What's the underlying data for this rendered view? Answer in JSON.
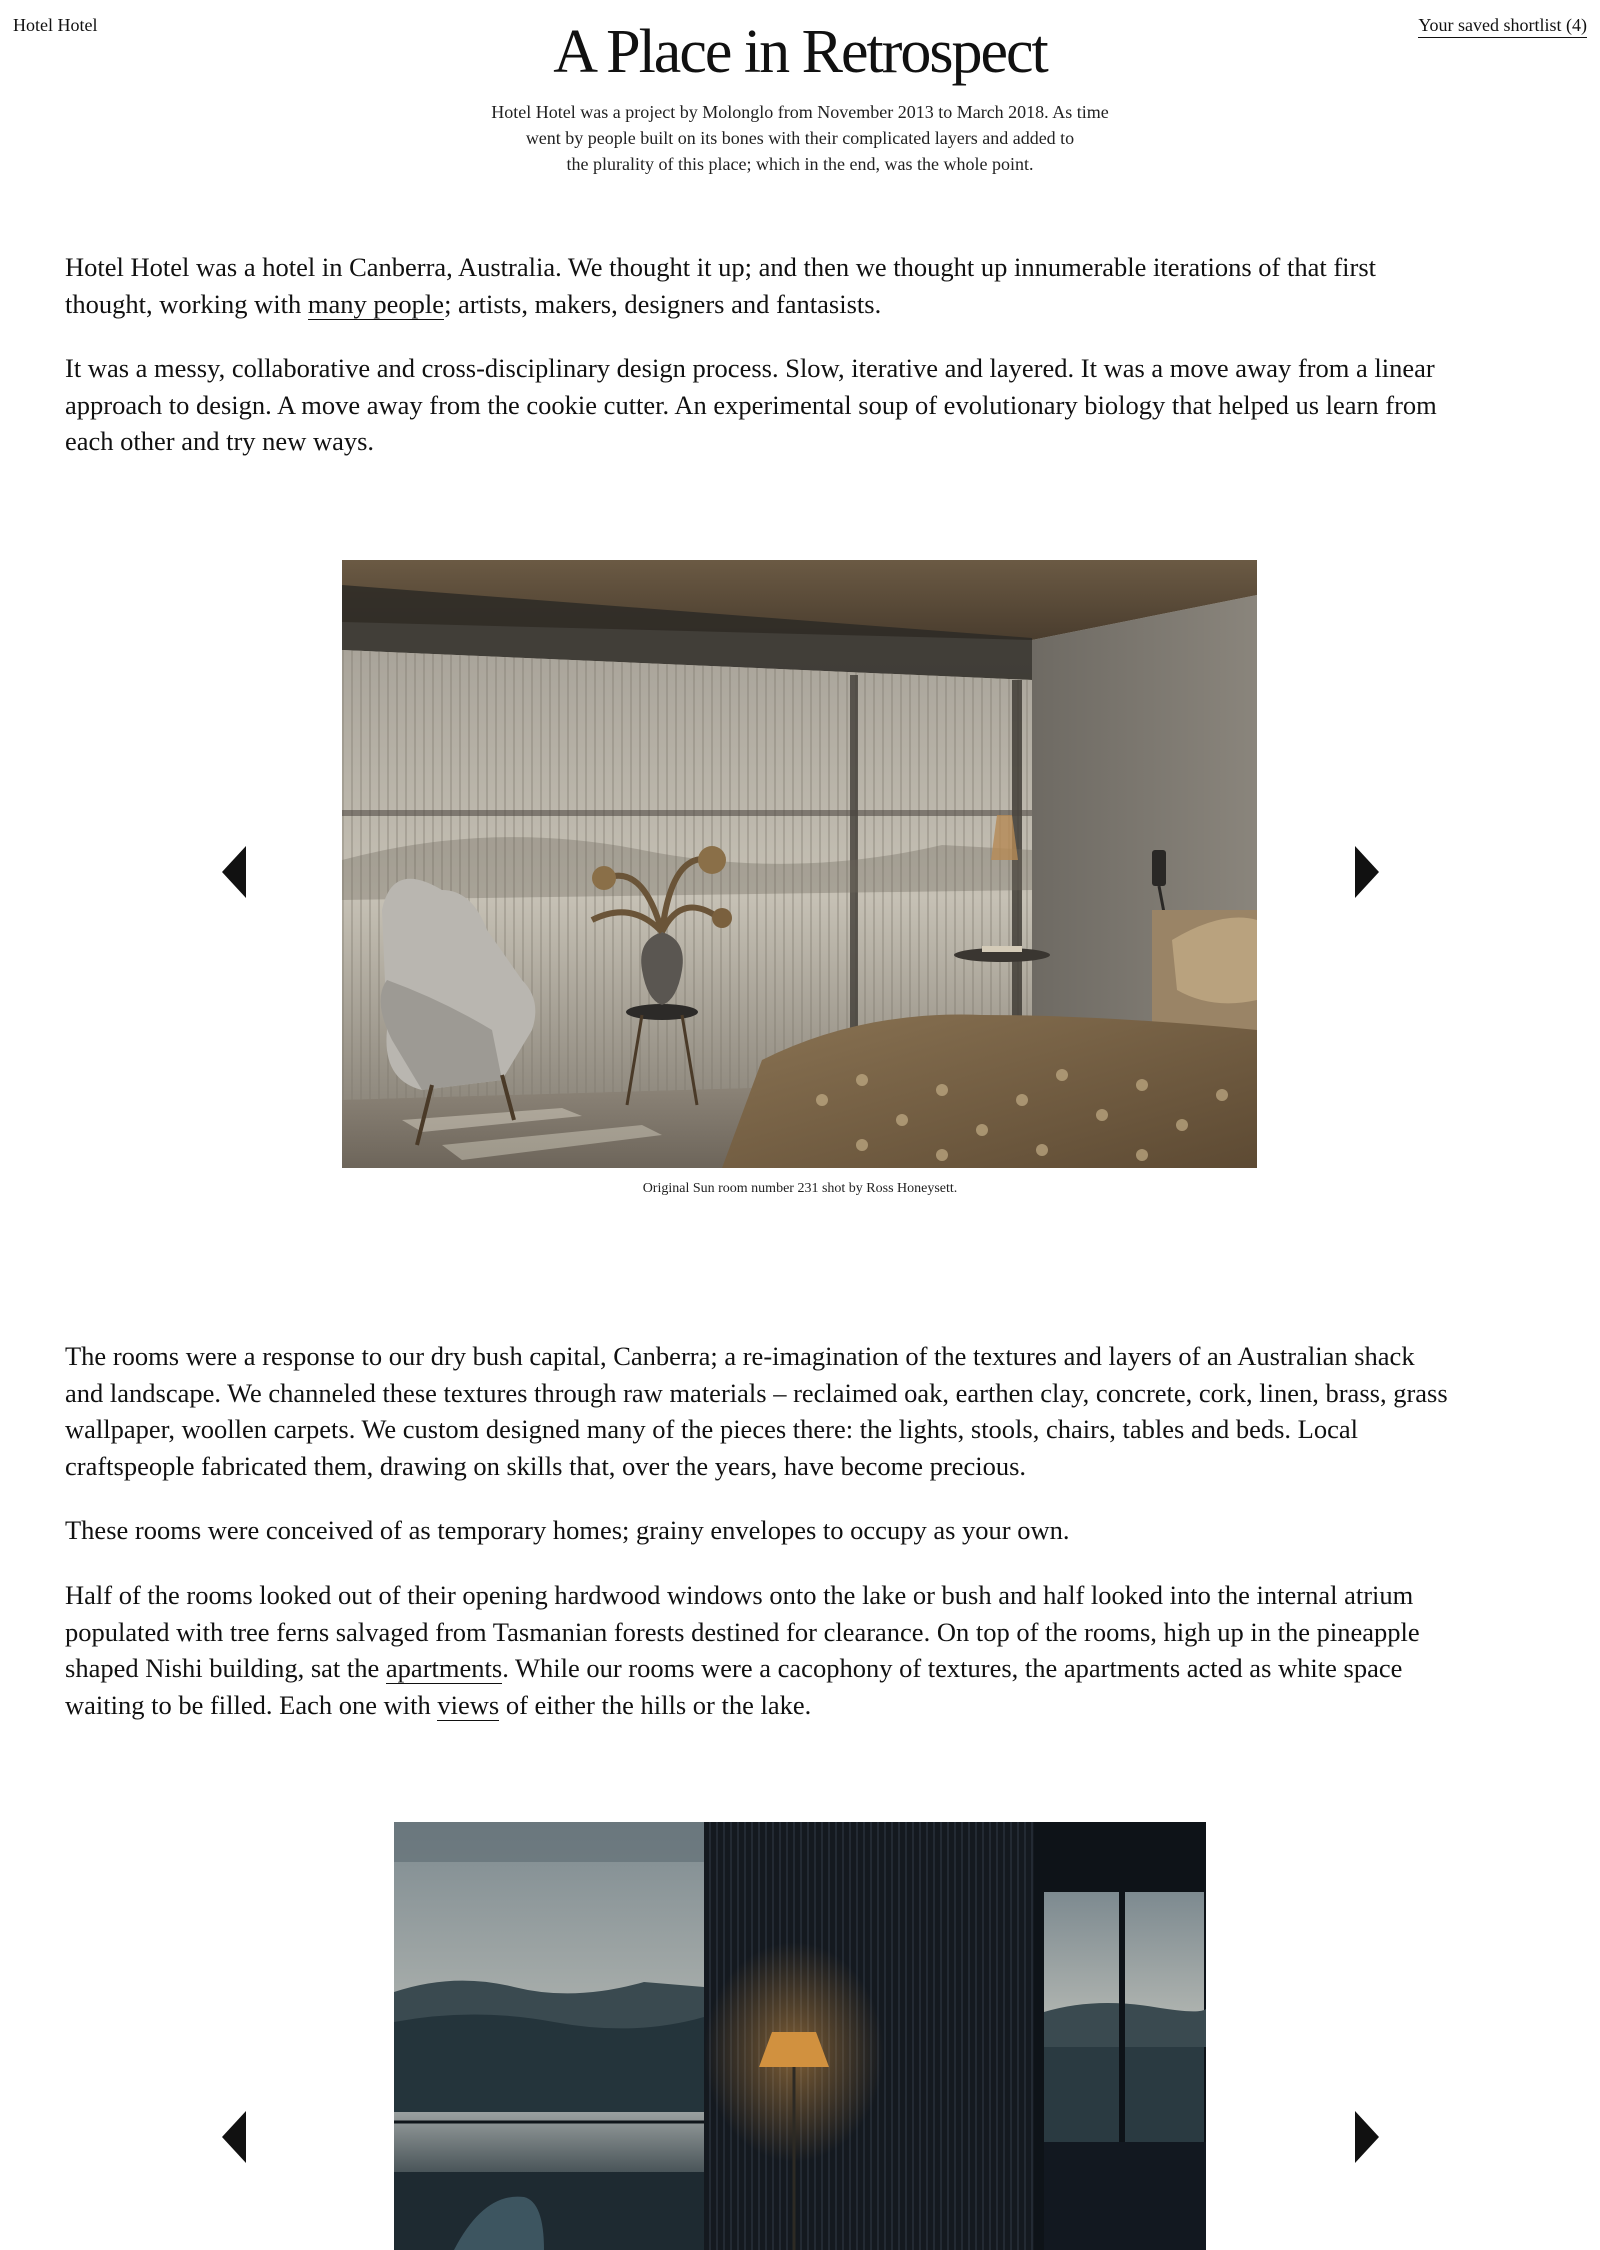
{
  "header": {
    "site_name": "Hotel Hotel",
    "shortlist_label": "Your saved shortlist (4)"
  },
  "page": {
    "title": "A Place in Retrospect",
    "intro_lines": [
      "Hotel Hotel was a project by Molonglo from November 2013 to March 2018. As time",
      "went by people built on its bones with their complicated layers and added to",
      "the  plurality of this place; which in the end, was the whole point."
    ]
  },
  "paragraphs": {
    "p1": {
      "line1": "Hotel Hotel was a hotel in Canberra, Australia. We thought it up; and then we thought up innumerable iterations of that first",
      "line2_before": "thought, working with ",
      "line2_link": "many people",
      "line2_after": "; artists, makers, designers and fantasists."
    },
    "p2": {
      "lines": [
        "It was a messy, collaborative and cross-disciplinary design process. Slow, iterative and layered. It was a move away from a linear",
        "approach to design. A move away from the cookie cutter. An experimental soup of evolutionary biology that helped us learn from",
        "each other and try new ways."
      ]
    },
    "p3": {
      "lines": [
        "The rooms were a response to our dry bush capital, Canberra; a re-imagination of the textures and layers of an Australian shack",
        "and landscape. We channeled these textures through raw materials – reclaimed oak, earthen clay, concrete, cork, linen, brass, grass",
        "wallpaper, woollen carpets. We custom designed many of the pieces there: the lights, stools, chairs, tables and beds. Local",
        "craftspeople fabricated them, drawing on skills that, over the years, have become precious."
      ]
    },
    "p4": {
      "text": "These rooms were conceived of as temporary homes; grainy envelopes to occupy as your own."
    },
    "p5": {
      "line1": "Half of the rooms looked out of their opening hardwood windows onto the lake or bush and half looked into the internal atrium",
      "line2": "populated with tree ferns salvaged from Tasmanian forests destined for clearance. On top of the rooms, high up in the pineapple",
      "line3_before": "shaped Nishi building, sat the ",
      "line3_link": "apartments",
      "line3_after": ". While our rooms were a cacophony of textures, the apartments acted as white space",
      "line4_before": "waiting to be filled. Each one with ",
      "line4_link": "views",
      "line4_after": " of either the hills or the lake."
    }
  },
  "gallery1": {
    "caption": "Original Sun room number 231 shot by Ross Honeysett.",
    "prev_icon": "triangle-left-icon",
    "next_icon": "triangle-right-icon"
  },
  "gallery2": {
    "prev_icon": "triangle-left-icon",
    "next_icon": "triangle-right-icon"
  }
}
